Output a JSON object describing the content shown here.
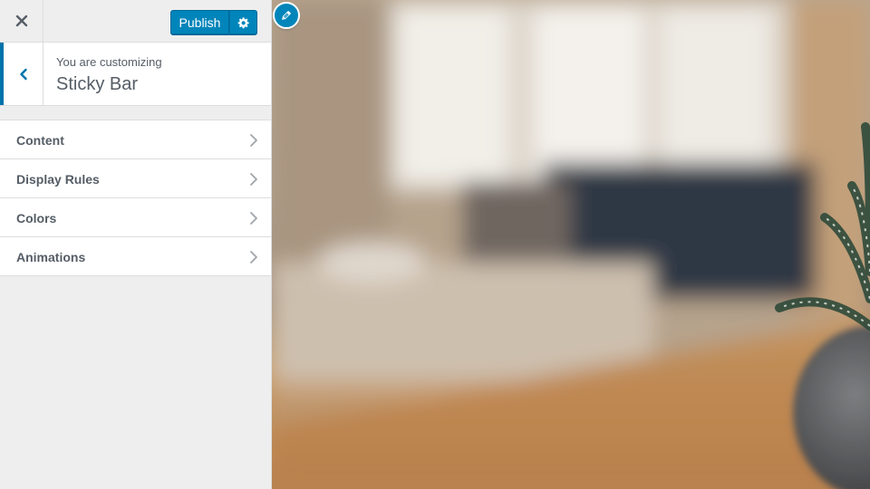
{
  "header": {
    "close_icon": "close-icon",
    "publish_label": "Publish",
    "settings_icon": "gear-icon",
    "accent_color": "#0085ba"
  },
  "title_panel": {
    "back_icon": "chevron-left-icon",
    "customizing_label": "You are customizing",
    "title": "Sticky Bar"
  },
  "sections": [
    {
      "label": "Content"
    },
    {
      "label": "Display Rules"
    },
    {
      "label": "Colors"
    },
    {
      "label": "Animations"
    }
  ],
  "preview": {
    "edit_shortcut_icon": "pencil-icon"
  }
}
